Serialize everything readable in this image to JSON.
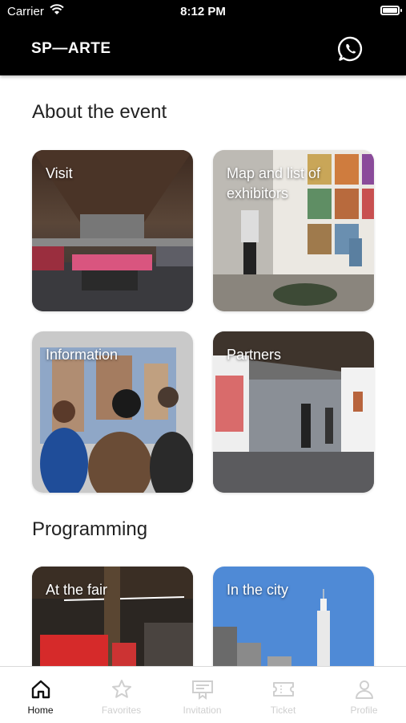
{
  "status_bar": {
    "carrier": "Carrier",
    "time": "8:12 PM"
  },
  "header": {
    "logo": "SP—ARTE",
    "right_icon": "whatsapp-icon"
  },
  "sections": [
    {
      "title": "About the event",
      "cards": [
        {
          "label": "Visit"
        },
        {
          "label": "Map and list of exhibitors"
        },
        {
          "label": "Information"
        },
        {
          "label": "Partners"
        }
      ]
    },
    {
      "title": "Programming",
      "cards": [
        {
          "label": "At the fair"
        },
        {
          "label": "In the city"
        }
      ]
    }
  ],
  "tab_bar": {
    "items": [
      {
        "label": "Home",
        "icon": "home-icon",
        "active": true
      },
      {
        "label": "Favorites",
        "icon": "star-icon",
        "active": false
      },
      {
        "label": "Invitation",
        "icon": "invitation-icon",
        "active": false
      },
      {
        "label": "Ticket",
        "icon": "ticket-icon",
        "active": false
      },
      {
        "label": "Profile",
        "icon": "profile-icon",
        "active": false
      }
    ]
  }
}
